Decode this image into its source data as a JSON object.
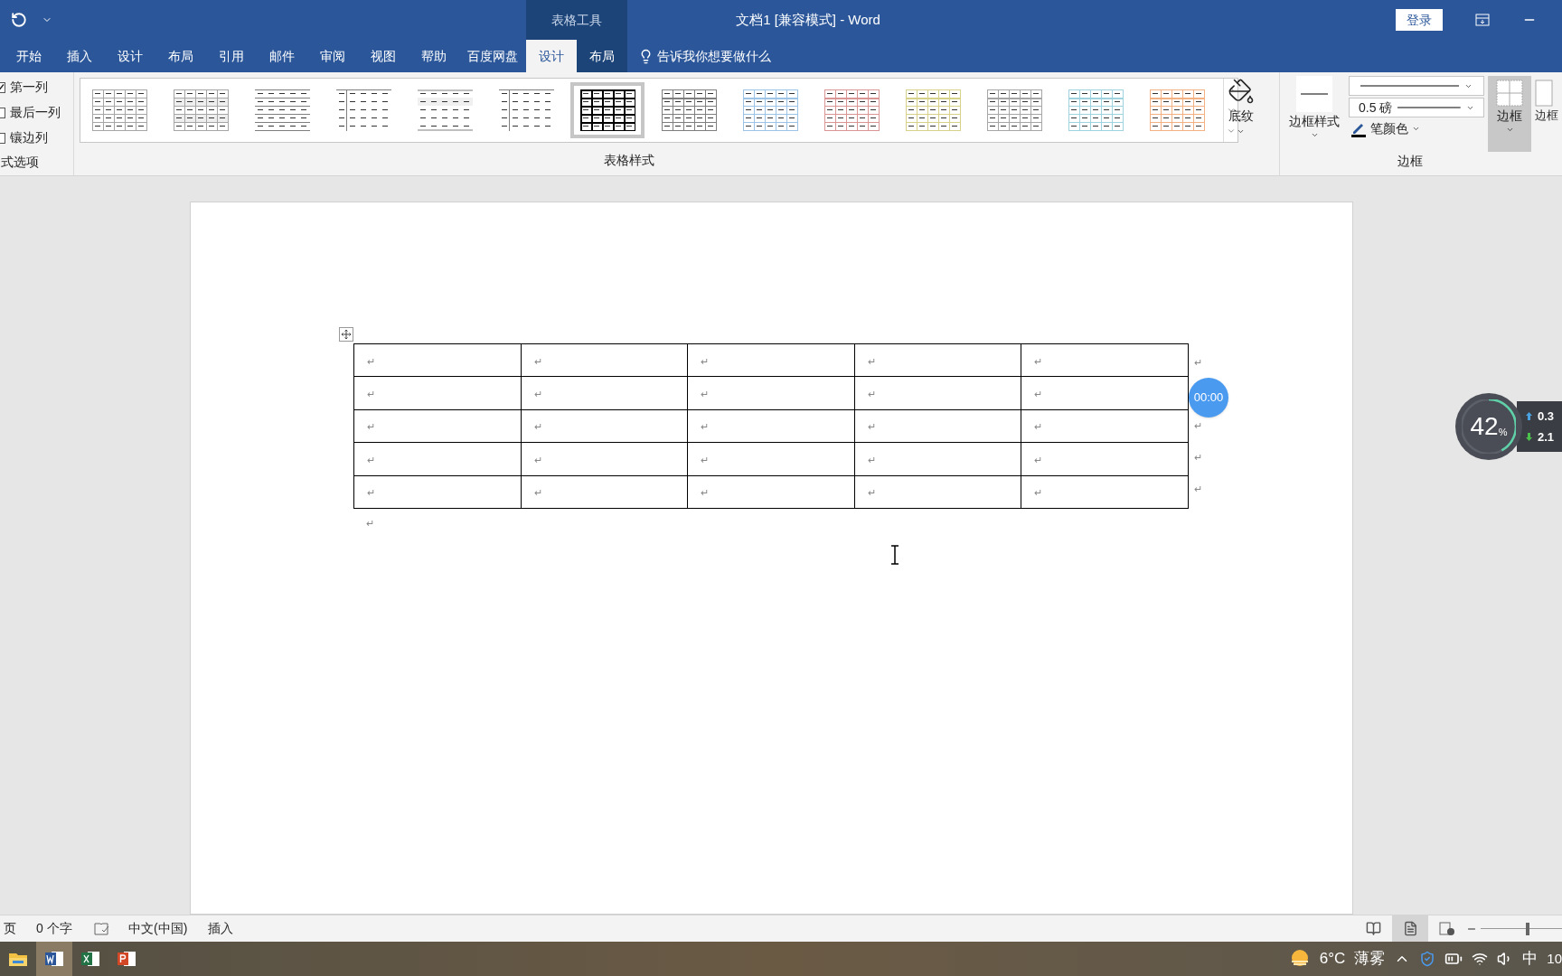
{
  "title_bar": {
    "contextual_label": "表格工具",
    "title": "文档1 [兼容模式] - Word",
    "sign_in": "登录"
  },
  "tabs": [
    {
      "label": "开始",
      "selected": false
    },
    {
      "label": "插入",
      "selected": false
    },
    {
      "label": "设计",
      "selected": false
    },
    {
      "label": "布局",
      "selected": false
    },
    {
      "label": "引用",
      "selected": false
    },
    {
      "label": "邮件",
      "selected": false
    },
    {
      "label": "审阅",
      "selected": false
    },
    {
      "label": "视图",
      "selected": false
    },
    {
      "label": "帮助",
      "selected": false
    },
    {
      "label": "百度网盘",
      "selected": false
    }
  ],
  "contextual_tabs": [
    {
      "label": "设计",
      "selected": true
    },
    {
      "label": "布局",
      "selected": false
    }
  ],
  "tell_me": "告诉我你想要做什么",
  "style_options": {
    "group_label": "式选项",
    "items": [
      {
        "label": "第一列",
        "checked": true
      },
      {
        "label": "最后一列",
        "checked": false
      },
      {
        "label": "镶边列",
        "checked": false
      }
    ]
  },
  "table_styles": {
    "group_label": "表格样式",
    "styles": [
      {
        "kind": "grid",
        "color": "#a6a6a6",
        "selected": false
      },
      {
        "kind": "shaded",
        "color": "#a6a6a6",
        "selected": false
      },
      {
        "kind": "lines",
        "color": "#7f7f7f",
        "selected": false
      },
      {
        "kind": "open",
        "color": "#7f7f7f",
        "selected": false
      },
      {
        "kind": "plain",
        "color": "#bfbfbf",
        "selected": false
      },
      {
        "kind": "open",
        "color": "#7f7f7f",
        "selected": false
      },
      {
        "kind": "grid",
        "color": "#000000",
        "selected": true
      },
      {
        "kind": "header",
        "color": "#7f7f7f",
        "selected": false
      },
      {
        "kind": "header",
        "color": "#9dc3e6",
        "selected": false
      },
      {
        "kind": "header",
        "color": "#d99694",
        "selected": false
      },
      {
        "kind": "header",
        "color": "#d6d28a",
        "selected": false
      },
      {
        "kind": "header",
        "color": "#a6a6a6",
        "selected": false
      },
      {
        "kind": "header",
        "color": "#9fd3e0",
        "selected": false
      },
      {
        "kind": "header",
        "color": "#f4b183",
        "selected": false
      }
    ]
  },
  "shading": {
    "label": "底纹"
  },
  "borders": {
    "group_label": "边框",
    "border_styles_label": "边框样式",
    "pen_weight": "0.5 磅",
    "pen_color_label": "笔颜色",
    "borders_label": "边框",
    "border_painter_label": "边框"
  },
  "document": {
    "rows": [
      {
        "cells": [
          "↵",
          "↵",
          "↵",
          "↵",
          "↵"
        ],
        "end_mark": "↵"
      },
      {
        "cells": [
          "↵",
          "↵",
          "↵",
          "↵",
          "↵"
        ]
      },
      {
        "cells": [
          "↵",
          "↵",
          "↵",
          "↵",
          "↵"
        ],
        "end_mark": "↵"
      },
      {
        "cells": [
          "↵",
          "↵",
          "↵",
          "↵",
          "↵"
        ],
        "end_mark": "↵"
      },
      {
        "cells": [
          "↵",
          "↵",
          "↵",
          "↵",
          "↵"
        ],
        "end_mark": "↵"
      }
    ],
    "after_table_mark": "↵"
  },
  "timer": "00:00",
  "speed_widget": {
    "percent": "42",
    "unit": "%",
    "upload": "0.3",
    "download": "2.1"
  },
  "status_bar": {
    "page": "页",
    "word_count": "0 个字",
    "language": "中文(中国)",
    "mode": "插入",
    "zoom_slider": {
      "level": 0.55
    }
  },
  "taskbar": {
    "apps": [
      {
        "kind": "explorer",
        "selected": false
      },
      {
        "kind": "word",
        "selected": true
      },
      {
        "kind": "excel",
        "selected": false
      },
      {
        "kind": "powerpoint",
        "selected": false
      }
    ],
    "temperature": "6°C",
    "weather": "薄雾",
    "ime": "中",
    "clock": "10"
  }
}
